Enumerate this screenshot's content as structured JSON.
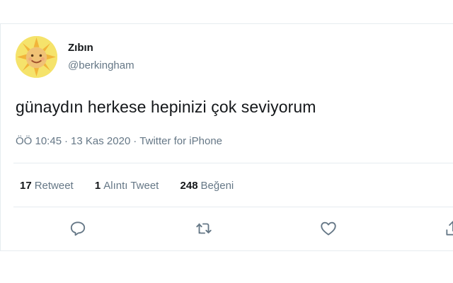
{
  "user": {
    "display_name": "Zıbın",
    "handle": "@berkingham",
    "avatar_icon": "sun-baby-avatar"
  },
  "tweet": {
    "text": "günaydın herkese hepinizi çok seviyorum",
    "time": "ÖÖ 10:45",
    "date": "13 Kas 2020",
    "source": "Twitter for iPhone",
    "separator": "·"
  },
  "stats": {
    "retweets_count": "17",
    "retweets_label": "Retweet",
    "quotes_count": "1",
    "quotes_label": "Alıntı Tweet",
    "likes_count": "248",
    "likes_label": "Beğeni"
  },
  "actions": [
    {
      "icon": "reply-icon"
    },
    {
      "icon": "retweet-icon"
    },
    {
      "icon": "like-icon"
    },
    {
      "icon": "share-icon"
    }
  ],
  "colors": {
    "text_primary": "#14171a",
    "text_secondary": "#657786",
    "border": "#e6ecf0"
  }
}
